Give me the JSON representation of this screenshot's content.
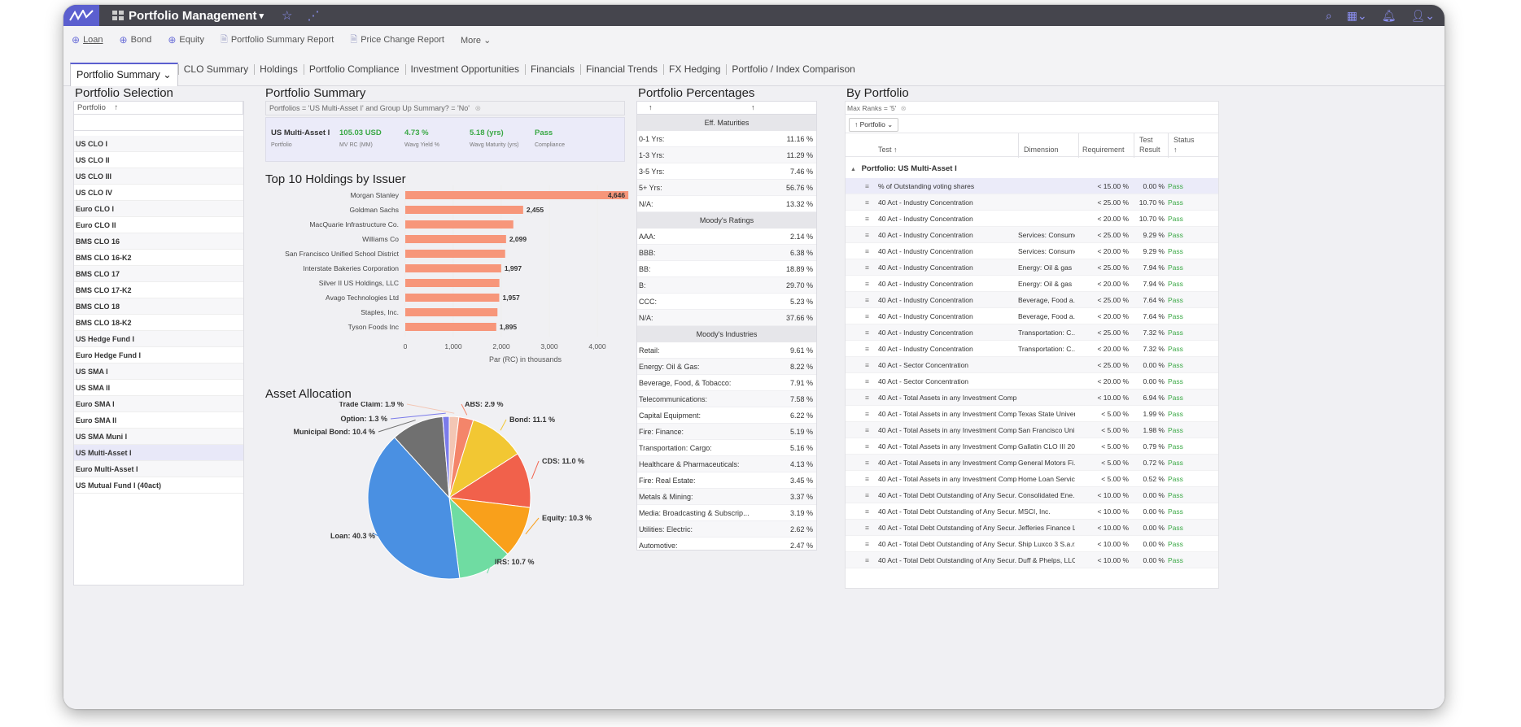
{
  "app": {
    "title": "Portfolio Management",
    "title_caret": "▾"
  },
  "toolbar": [
    {
      "icon": "plus-circle-icon",
      "label": "Loan",
      "underline": true
    },
    {
      "icon": "plus-circle-icon",
      "label": "Bond"
    },
    {
      "icon": "plus-circle-icon",
      "label": "Equity"
    },
    {
      "icon": "document-icon",
      "label": "Portfolio Summary Report"
    },
    {
      "icon": "document-icon",
      "label": "Price Change Report"
    },
    {
      "icon": "",
      "label": "More ⌄"
    }
  ],
  "tabs": [
    "Portfolio Summary ⌄",
    "CLO Summary",
    "Holdings",
    "Portfolio Compliance",
    "Investment Opportunities",
    "Financials",
    "Financial Trends",
    "FX Hedging",
    "Portfolio / Index Comparison"
  ],
  "selection": {
    "title": "Portfolio Selection",
    "column": "Portfolio",
    "sort_glyph": "↑",
    "items": [
      "US CLO I",
      "US CLO II",
      "US CLO III",
      "US CLO IV",
      "Euro CLO I",
      "Euro CLO II",
      "BMS CLO 16",
      "BMS CLO 16-K2",
      "BMS CLO 17",
      "BMS CLO 17-K2",
      "BMS CLO 18",
      "BMS CLO 18-K2",
      "US Hedge Fund I",
      "Euro Hedge Fund I",
      "US SMA I",
      "US SMA II",
      "Euro SMA I",
      "Euro SMA II",
      "US SMA Muni I",
      "US Multi-Asset I",
      "Euro Multi-Asset I",
      "US Mutual Fund I (40act)"
    ],
    "selected": "US Multi-Asset I"
  },
  "summary": {
    "title": "Portfolio Summary",
    "filter": "Portfolios = 'US Multi-Asset I' and Group Up Summary? = 'No'",
    "portfolio": "US Multi-Asset I",
    "portfolio_label": "Portfolio",
    "mv": "105.03 USD",
    "mv_label": "MV RC (MM)",
    "yield": "4.73 %",
    "yield_label": "Wavg Yield %",
    "maturity": "5.18 (yrs)",
    "maturity_label": "Wavg Maturity (yrs)",
    "compliance": "Pass",
    "compliance_label": "Compliance",
    "value_color": "#3aa845"
  },
  "holdings": {
    "title": "Top 10 Holdings by Issuer",
    "xlabel": "Par (RC) in thousands"
  },
  "allocation": {
    "title": "Asset Allocation"
  },
  "chart_data": [
    {
      "type": "bar",
      "orientation": "horizontal",
      "categories": [
        "Morgan Stanley",
        "Goldman Sachs",
        "MacQuarie Infrastructure Co.",
        "Williams Co",
        "San Francisco Unified School District",
        "Interstate Bakeries Corporation",
        "Silver II US Holdings, LLC",
        "Avago Technologies Ltd",
        "Staples, Inc.",
        "Tyson Foods Inc"
      ],
      "values": [
        4646,
        2455,
        2250,
        2099,
        2080,
        1997,
        1960,
        1957,
        1920,
        1895
      ],
      "data_labels": [
        "4,646",
        "2,455",
        "",
        "2,099",
        "",
        "1,997",
        "",
        "1,957",
        "",
        "1,895"
      ],
      "xlabel": "Par (RC) in thousands",
      "xlim": [
        0,
        5000
      ],
      "xticks": [
        "0",
        "1,000",
        "2,000",
        "3,000",
        "4,000",
        "5,000"
      ],
      "color": "#f7967a",
      "highlight_color": "#f26d4d"
    },
    {
      "type": "pie",
      "slices": [
        {
          "label": "Trade Claim: 1.9 %",
          "value": 1.9,
          "color": "#f3c6b4"
        },
        {
          "label": "ABS: 2.9 %",
          "value": 2.9,
          "color": "#f4856a"
        },
        {
          "label": "Bond: 11.1 %",
          "value": 11.1,
          "color": "#f2c733"
        },
        {
          "label": "CDS: 11.0 %",
          "value": 11.0,
          "color": "#f1614b"
        },
        {
          "label": "Equity: 10.3 %",
          "value": 10.3,
          "color": "#f9a01b"
        },
        {
          "label": "IRS: 10.7 %",
          "value": 10.7,
          "color": "#6fdca2"
        },
        {
          "label": "Loan: 40.3 %",
          "value": 40.3,
          "color": "#4a90e2"
        },
        {
          "label": "Municipal Bond: 10.4 %",
          "value": 10.4,
          "color": "#707070"
        },
        {
          "label": "Option: 1.3 %",
          "value": 1.3,
          "color": "#7b7bea"
        }
      ]
    }
  ],
  "percentages": {
    "title": "Portfolio Percentages",
    "head": [
      "↑",
      "↑"
    ],
    "groups": [
      {
        "name": "Eff. Maturities",
        "rows": [
          [
            "0-1 Yrs:",
            "11.16 %"
          ],
          [
            "1-3 Yrs:",
            "11.29 %"
          ],
          [
            "3-5 Yrs:",
            "7.46 %"
          ],
          [
            "5+ Yrs:",
            "56.76 %"
          ],
          [
            "N/A:",
            "13.32 %"
          ]
        ]
      },
      {
        "name": "Moody's Ratings",
        "rows": [
          [
            "AAA:",
            "2.14 %"
          ],
          [
            "BBB:",
            "6.38 %"
          ],
          [
            "BB:",
            "18.89 %"
          ],
          [
            "B:",
            "29.70 %"
          ],
          [
            "CCC:",
            "5.23 %"
          ],
          [
            "N/A:",
            "37.66 %"
          ]
        ]
      },
      {
        "name": "Moody's Industries",
        "rows": [
          [
            "Retail:",
            "9.61 %"
          ],
          [
            "Energy: Oil & Gas:",
            "8.22 %"
          ],
          [
            "Beverage, Food, & Tobacco:",
            "7.91 %"
          ],
          [
            "Telecommunications:",
            "7.58 %"
          ],
          [
            "Capital Equipment:",
            "6.22 %"
          ],
          [
            "Fire: Finance:",
            "5.19 %"
          ],
          [
            "Transportation: Cargo:",
            "5.16 %"
          ],
          [
            "Healthcare & Pharmaceuticals:",
            "4.13 %"
          ],
          [
            "Fire: Real Estate:",
            "3.45 %"
          ],
          [
            "Metals & Mining:",
            "3.37 %"
          ],
          [
            "Media: Broadcasting & Subscrip...",
            "3.19 %"
          ],
          [
            "Utilities: Electric:",
            "2.62 %"
          ],
          [
            "Automotive:",
            "2.47 %"
          ]
        ]
      }
    ]
  },
  "byportfolio": {
    "title": "By Portfolio",
    "filter": "Max Ranks = '5'",
    "group_chip": "↑  Portfolio  ⌄",
    "headers": {
      "test": "Test ↑",
      "dimension": "Dimension",
      "requirement": "Requirement",
      "result": "Test Result",
      "status": "Status ↑"
    },
    "group": "Portfolio: US Multi-Asset I",
    "rows": [
      [
        "% of Outstanding voting shares",
        "",
        "< 15.00 %",
        "0.00 %",
        "Pass"
      ],
      [
        "40 Act - Industry Concentration",
        "",
        "< 25.00 %",
        "10.70 %",
        "Pass"
      ],
      [
        "40 Act - Industry Concentration",
        "",
        "< 20.00 %",
        "10.70 %",
        "Pass"
      ],
      [
        "40 Act - Industry Concentration",
        "Services: Consumer",
        "< 25.00 %",
        "9.29 %",
        "Pass"
      ],
      [
        "40 Act - Industry Concentration",
        "Services: Consumer",
        "< 20.00 %",
        "9.29 %",
        "Pass"
      ],
      [
        "40 Act - Industry Concentration",
        "Energy: Oil & gas",
        "< 25.00 %",
        "7.94 %",
        "Pass"
      ],
      [
        "40 Act - Industry Concentration",
        "Energy: Oil & gas",
        "< 20.00 %",
        "7.94 %",
        "Pass"
      ],
      [
        "40 Act - Industry Concentration",
        "Beverage, Food a...",
        "< 25.00 %",
        "7.64 %",
        "Pass"
      ],
      [
        "40 Act - Industry Concentration",
        "Beverage, Food a...",
        "< 20.00 %",
        "7.64 %",
        "Pass"
      ],
      [
        "40 Act - Industry Concentration",
        "Transportation: C...",
        "< 25.00 %",
        "7.32 %",
        "Pass"
      ],
      [
        "40 Act - Industry Concentration",
        "Transportation: C...",
        "< 20.00 %",
        "7.32 %",
        "Pass"
      ],
      [
        "40 Act - Sector Concentration",
        "",
        "< 25.00 %",
        "0.00 %",
        "Pass"
      ],
      [
        "40 Act - Sector Concentration",
        "",
        "< 20.00 %",
        "0.00 %",
        "Pass"
      ],
      [
        "40 Act - Total Assets in any Investment Comp...",
        "",
        "< 10.00 %",
        "6.94 %",
        "Pass"
      ],
      [
        "40 Act - Total Assets in any Investment Comp...",
        "Texas State Univer...",
        "< 5.00 %",
        "1.99 %",
        "Pass"
      ],
      [
        "40 Act - Total Assets in any Investment Comp...",
        "San Francisco Uni...",
        "< 5.00 %",
        "1.98 %",
        "Pass"
      ],
      [
        "40 Act - Total Assets in any Investment Comp...",
        "Gallatin CLO III 20...",
        "< 5.00 %",
        "0.79 %",
        "Pass"
      ],
      [
        "40 Act - Total Assets in any Investment Comp...",
        "General Motors Fi...",
        "< 5.00 %",
        "0.72 %",
        "Pass"
      ],
      [
        "40 Act - Total Assets in any Investment Comp...",
        "Home Loan Servic...",
        "< 5.00 %",
        "0.52 %",
        "Pass"
      ],
      [
        "40 Act - Total Debt Outstanding of Any Secur...",
        "Consolidated Ene...",
        "< 10.00 %",
        "0.00 %",
        "Pass"
      ],
      [
        "40 Act - Total Debt Outstanding of Any Secur...",
        "MSCI, Inc.",
        "< 10.00 %",
        "0.00 %",
        "Pass"
      ],
      [
        "40 Act - Total Debt Outstanding of Any Secur...",
        "Jefferies Finance L...",
        "< 10.00 %",
        "0.00 %",
        "Pass"
      ],
      [
        "40 Act - Total Debt Outstanding of Any Secur...",
        "Ship Luxco 3 S.a.r....",
        "< 10.00 %",
        "0.00 %",
        "Pass"
      ],
      [
        "40 Act - Total Debt Outstanding of Any Secur...",
        "Duff & Phelps, LLC",
        "< 10.00 %",
        "0.00 %",
        "Pass"
      ]
    ]
  }
}
